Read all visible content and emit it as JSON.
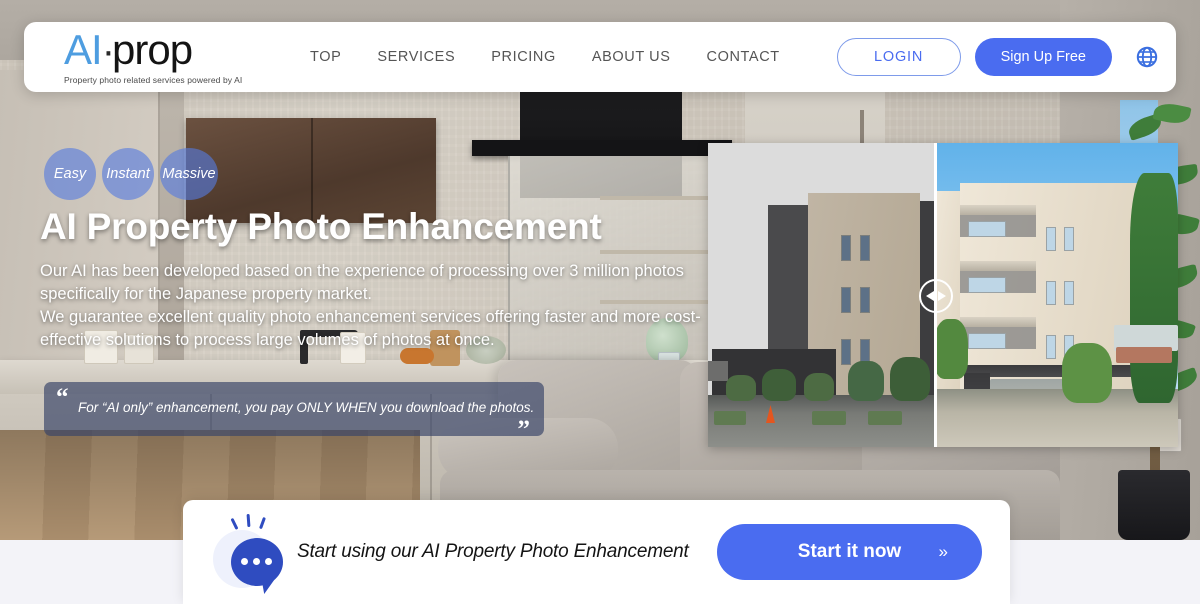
{
  "header": {
    "logo": {
      "primary": "AI",
      "separator": "·",
      "secondary": "prop",
      "tagline": "Property photo related services powered by AI"
    },
    "nav": [
      {
        "label": "TOP"
      },
      {
        "label": "SERVICES"
      },
      {
        "label": "PRICING"
      },
      {
        "label": "ABOUT US"
      },
      {
        "label": "CONTACT"
      }
    ],
    "login_label": "LOGIN",
    "signup_label": "Sign Up Free",
    "language_icon": "globe-icon"
  },
  "hero": {
    "badges": [
      {
        "label": "Easy"
      },
      {
        "label": "Instant"
      },
      {
        "label": "Massive"
      }
    ],
    "title": "AI Property Photo Enhancement",
    "body_line1": "Our AI has been developed based on the experience of processing over 3 million photos",
    "body_line2": "specifically for the Japanese property market.",
    "body_line3": "We guarantee excellent quality photo enhancement services offering faster and more cost-",
    "body_line4": "effective solutions to process large volumes of photos at once.",
    "quote": {
      "open_mark": "“",
      "text": "For “AI only” enhancement, you pay ONLY WHEN you download the photos.",
      "close_mark": "”"
    }
  },
  "comparison": {
    "before_label": "before-image",
    "after_label": "after-image",
    "handle_icon": "left-right-arrows-icon"
  },
  "cta": {
    "icon": "chat-bubble-icon",
    "text": "Start using our AI Property Photo Enhancement",
    "button_label": "Start it now",
    "button_chevron": "»"
  },
  "colors": {
    "accent_blue": "#4a6cf0",
    "logo_blue": "#4e9de0",
    "bubble_blue": "#2f4cc0",
    "badge_blue": "rgba(86,122,222,.62)",
    "quote_bg": "rgba(58,70,104,.68)",
    "below_bg": "#f3f3f8"
  }
}
